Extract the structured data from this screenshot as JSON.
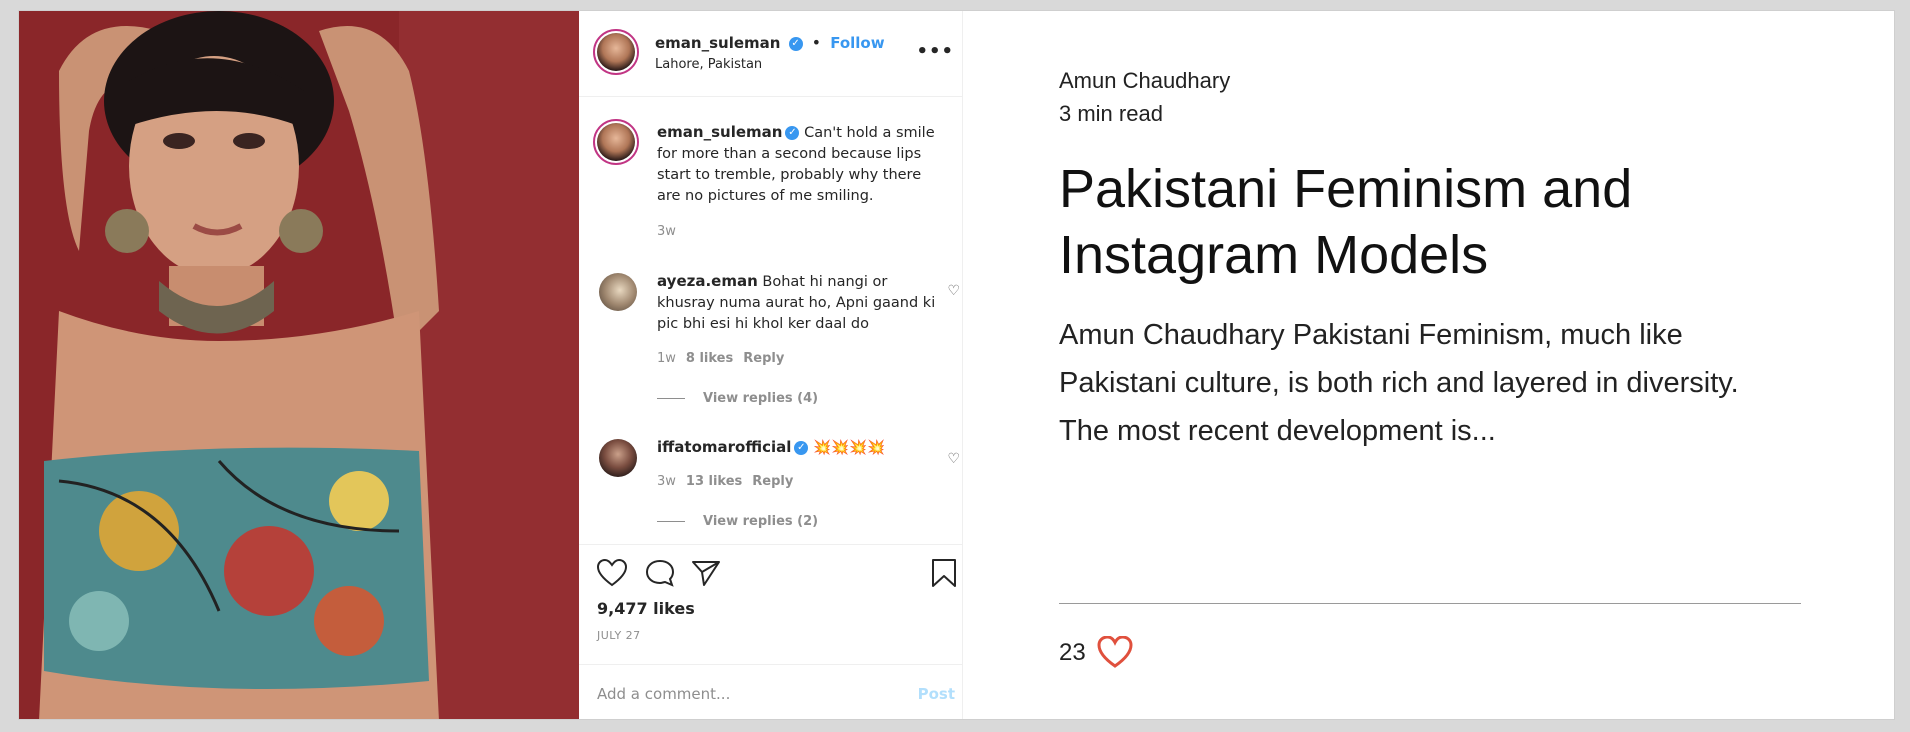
{
  "post": {
    "username": "eman_suleman",
    "follow_label": "Follow",
    "location": "Lahore, Pakistan",
    "more_icon": "more-dots-icon",
    "caption": {
      "username": "eman_suleman",
      "text": "Can't hold a smile for more than a second because lips start to tremble, probably why there are no pictures of me smiling.",
      "time": "3w"
    },
    "comments": [
      {
        "username": "ayeza.eman",
        "text": "Bohat hi nangi or khusray numa aurat ho, Apni gaand ki pic bhi esi hi khol ker daal do",
        "time": "1w",
        "likes": "8 likes",
        "reply": "Reply",
        "view_replies": "View replies (4)"
      },
      {
        "username": "iffatomarofficial",
        "text": "💥💥💥💥",
        "time": "3w",
        "likes": "13 likes",
        "reply": "Reply",
        "view_replies": "View replies (2)"
      }
    ],
    "like_count": "9,477 likes",
    "date": "JULY 27",
    "comment_placeholder": "Add a comment...",
    "post_label": "Post"
  },
  "article": {
    "author": "Amun Chaudhary",
    "read_time": "3 min read",
    "title": "Pakistani Feminism and Instagram Models",
    "excerpt": "Amun Chaudhary Pakistani Feminism, much like Pakistani culture, is both rich and layered in diversity. The most recent development is...",
    "like_count": "23"
  },
  "colors": {
    "accent_blue": "#3897f0",
    "heart_red": "#e0503d",
    "photo_bg": "#8e2a2d"
  }
}
